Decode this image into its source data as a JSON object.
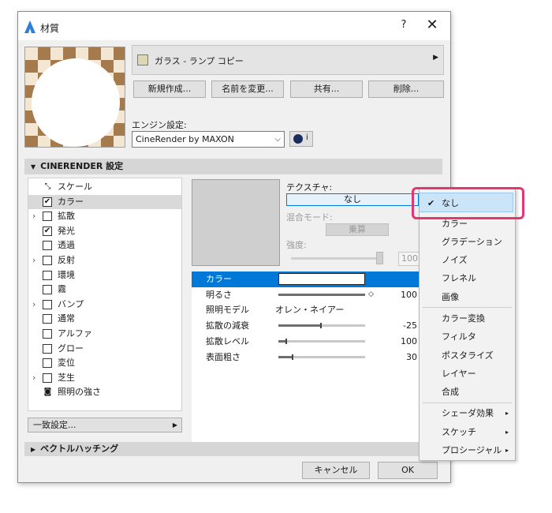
{
  "window": {
    "title": "材質",
    "help": "?",
    "close": "✕"
  },
  "material": {
    "name": "ガラス - ランプ コピー",
    "swatch_color": "#ddd8b4"
  },
  "buttons": {
    "new": "新規作成...",
    "rename": "名前を変更...",
    "share": "共有...",
    "delete": "削除..."
  },
  "engine": {
    "label": "エンジン設定:",
    "value": "CineRender by MAXON",
    "info": "i"
  },
  "section": {
    "title": "CINERENDER 設定",
    "vector_title": "ベクトルハッチング"
  },
  "channels": [
    {
      "label": "スケール",
      "kind": "scale",
      "expand": "",
      "checked": ""
    },
    {
      "label": "カラー",
      "kind": "check",
      "expand": "",
      "checked": "✔"
    },
    {
      "label": "拡散",
      "kind": "check",
      "expand": "›",
      "checked": ""
    },
    {
      "label": "発光",
      "kind": "check",
      "expand": "",
      "checked": "✔"
    },
    {
      "label": "透過",
      "kind": "check",
      "expand": "",
      "checked": ""
    },
    {
      "label": "反射",
      "kind": "check",
      "expand": "›",
      "checked": ""
    },
    {
      "label": "環境",
      "kind": "check",
      "expand": "",
      "checked": ""
    },
    {
      "label": "霧",
      "kind": "check",
      "expand": "",
      "checked": ""
    },
    {
      "label": "バンプ",
      "kind": "check",
      "expand": "›",
      "checked": ""
    },
    {
      "label": "通常",
      "kind": "check",
      "expand": "",
      "checked": ""
    },
    {
      "label": "アルファ",
      "kind": "check",
      "expand": "",
      "checked": ""
    },
    {
      "label": "グロー",
      "kind": "check",
      "expand": "",
      "checked": ""
    },
    {
      "label": "変位",
      "kind": "check",
      "expand": "",
      "checked": ""
    },
    {
      "label": "芝生",
      "kind": "check",
      "expand": "›",
      "checked": ""
    },
    {
      "label": "照明の強さ",
      "kind": "light",
      "expand": "",
      "checked": ""
    }
  ],
  "match_settings": "一致設定...",
  "texture": {
    "label": "テクスチャ:",
    "value": "なし",
    "blend_label": "混合モード:",
    "blend_value": "乗算",
    "intensity_label": "強度:",
    "intensity_value": "100."
  },
  "properties": [
    {
      "name": "カラー",
      "type": "color",
      "value": ""
    },
    {
      "name": "明るさ",
      "type": "slider",
      "value": "100",
      "fill": 1.0
    },
    {
      "name": "照明モデル",
      "type": "text",
      "value": "オレン・ネイアー"
    },
    {
      "name": "拡散の減衰",
      "type": "mark",
      "value": "-25",
      "fill": 0.48
    },
    {
      "name": "拡散レベル",
      "type": "mark",
      "value": "100",
      "fill": 0.08
    },
    {
      "name": "表面粗さ",
      "type": "mark",
      "value": "30",
      "fill": 0.15
    }
  ],
  "footer": {
    "cancel": "キャンセル",
    "ok": "OK"
  },
  "dropdown": {
    "selected": "なし",
    "items": [
      {
        "label": "なし",
        "check": "✔",
        "sub": ""
      },
      {
        "label": "カラー",
        "check": "",
        "sub": ""
      },
      {
        "label": "グラデーション",
        "check": "",
        "sub": ""
      },
      {
        "label": "ノイズ",
        "check": "",
        "sub": ""
      },
      {
        "label": "フレネル",
        "check": "",
        "sub": ""
      },
      {
        "label": "画像",
        "check": "",
        "sub": ""
      },
      {
        "label": "カラー変換",
        "check": "",
        "sub": ""
      },
      {
        "label": "フィルタ",
        "check": "",
        "sub": ""
      },
      {
        "label": "ポスタライズ",
        "check": "",
        "sub": ""
      },
      {
        "label": "レイヤー",
        "check": "",
        "sub": ""
      },
      {
        "label": "合成",
        "check": "",
        "sub": ""
      },
      {
        "label": "シェーダ効果",
        "check": "",
        "sub": "▸"
      },
      {
        "label": "スケッチ",
        "check": "",
        "sub": "▸"
      },
      {
        "label": "プロシージャル",
        "check": "",
        "sub": "▸"
      }
    ]
  },
  "colors": {
    "accent": "#0078d7",
    "callout": "#e5366f",
    "menu_highlight": "#cce4f7"
  }
}
